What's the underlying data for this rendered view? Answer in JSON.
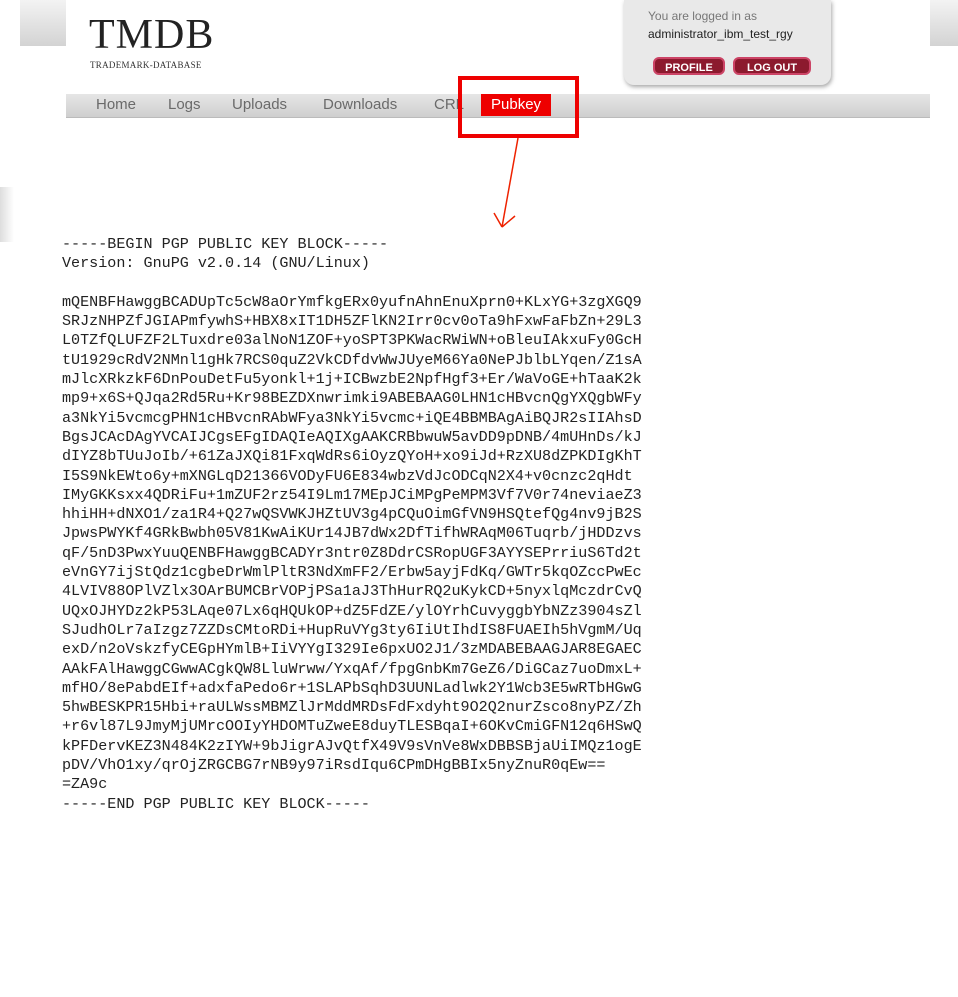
{
  "logo": {
    "title": "TMDB",
    "subtitle": "TRADEMARK-DATABASE"
  },
  "user": {
    "label": "You are logged in as",
    "name": "administrator_ibm_test_rgy"
  },
  "buttons": {
    "profile": "PROFILE",
    "logout": "LOG OUT"
  },
  "nav": [
    {
      "label": "Home"
    },
    {
      "label": "Logs"
    },
    {
      "label": "Uploads"
    },
    {
      "label": "Downloads"
    },
    {
      "label": "CRL"
    },
    {
      "label": "Pubkey",
      "active": true
    }
  ],
  "pgp": {
    "begin": "-----BEGIN PGP PUBLIC KEY BLOCK-----",
    "version": "Version: GnuPG v2.0.14 (GNU/Linux)",
    "lines": [
      "mQENBFHawggBCADUpTc5cW8aOrYmfkgERx0yufnAhnEnuXprn0+KLxYG+3zgXGQ9",
      "SRJzNHPZfJGIAPmfywhS+HBX8xIT1DH5ZFlKN2Irr0cv0oTa9hFxwFaFbZn+29L3",
      "L0TZfQLUFZF2LTuxdre03alNoN1ZOF+yoSPT3PKWacRWiWN+oBleuIAkxuFy0GcH",
      "tU1929cRdV2NMnl1gHk7RCS0quZ2VkCDfdvWwJUyeM66Ya0NePJblbLYqen/Z1sA",
      "mJlcXRkzkF6DnPouDetFu5yonkl+1j+ICBwzbE2NpfHgf3+Er/WaVoGE+hTaaK2k",
      "mp9+x6S+QJqa2Rd5Ru+Kr98BEZDXnwrimki9ABEBAAG0LHN1cHBvcnQgYXQgbWFy",
      "a3NkYi5vcmcgPHN1cHBvcnRAbWFya3NkYi5vcmc+iQE4BBMBAgAiBQJR2sIIAhsD",
      "BgsJCAcDAgYVCAIJCgsEFgIDAQIeAQIXgAAKCRBbwuW5avDD9pDNB/4mUHnDs/kJ",
      "dIYZ8bTUuJoIb/+61ZaJXQi81FxqWdRs6iOyzQYoH+xo9iJd+RzXU8dZPKDIgKhT",
      "I5S9NkEWto6y+mXNGLqD21366VODyFU6E834wbzVdJcODCqN2X4+v0cnzc2qHdt",
      "IMyGKKsxx4QDRiFu+1mZUF2rz54I9Lm17MEpJCiMPgPeMPM3Vf7V0r74neviaeZ3",
      "hhiHH+dNXO1/za1R4+Q27wQSVWKJHZtUV3g4pCQuOimGfVN9HSQtefQg4nv9jB2S",
      "JpwsPWYKf4GRkBwbh05V81KwAiKUr14JB7dWx2DfTifhWRAqM06Tuqrb/jHDDzvs",
      "qF/5nD3PwxYuuQENBFHawggBCADYr3ntr0Z8DdrCSRopUGF3AYYSEPrriuS6Td2t",
      "eVnGY7ijStQdz1cgbeDrWmlPltR3NdXmFF2/Erbw5ayjFdKq/GWTr5kqOZccPwEc",
      "4LVIV88OPlVZlx3OArBUMCBrVOPjPSa1aJ3ThHurRQ2uKykCD+5nyxlqMczdrCvQ",
      "UQxOJHYDz2kP53LAqe07Lx6qHQUkOP+dZ5FdZE/ylOYrhCuvyggbYbNZz3904sZl",
      "SJudhOLr7aIzgz7ZZDsCMtoRDi+HupRuVYg3ty6IiUtIhdIS8FUAEIh5hVgmM/Uq",
      "exD/n2oVskzfyCEGpHYmlB+IiVYYgI329Ie6pxUO2J1/3zMDABEBAAGJAR8EGAEC",
      "AAkFAlHawggCGwwACgkQW8LluWrww/YxqAf/fpgGnbKm7GeZ6/DiGCaz7uoDmxL+",
      "mfHO/8ePabdEIf+adxfaPedo6r+1SLAPbSqhD3UUNLadlwk2Y1Wcb3E5wRTbHGwG",
      "5hwBESKPR15Hbi+raULWssMBMZlJrMddMRDsFdFxdyht9O2Q2nurZsco8nyPZ/Zh",
      "+r6vl87L9JmyMjUMrcOOIyYHDOMTuZweE8duyTLESBqaI+6OKvCmiGFN12q6HSwQ",
      "kPFDervKEZ3N484K2zIYW+9bJigrAJvQtfX49V9sVnVe8WxDBBSBjaUiIMQz1ogE",
      "pDV/VhO1xy/qrOjZRGCBG7rNB9y97iRsdIqu6CPmDHgBBIx5nyZnuR0qEw==",
      "=ZA9c"
    ],
    "end": "-----END PGP PUBLIC KEY BLOCK-----"
  },
  "colors": {
    "accent": "#ee0000",
    "button": "#8c1a2e",
    "nav_text": "#6a6a6a"
  }
}
